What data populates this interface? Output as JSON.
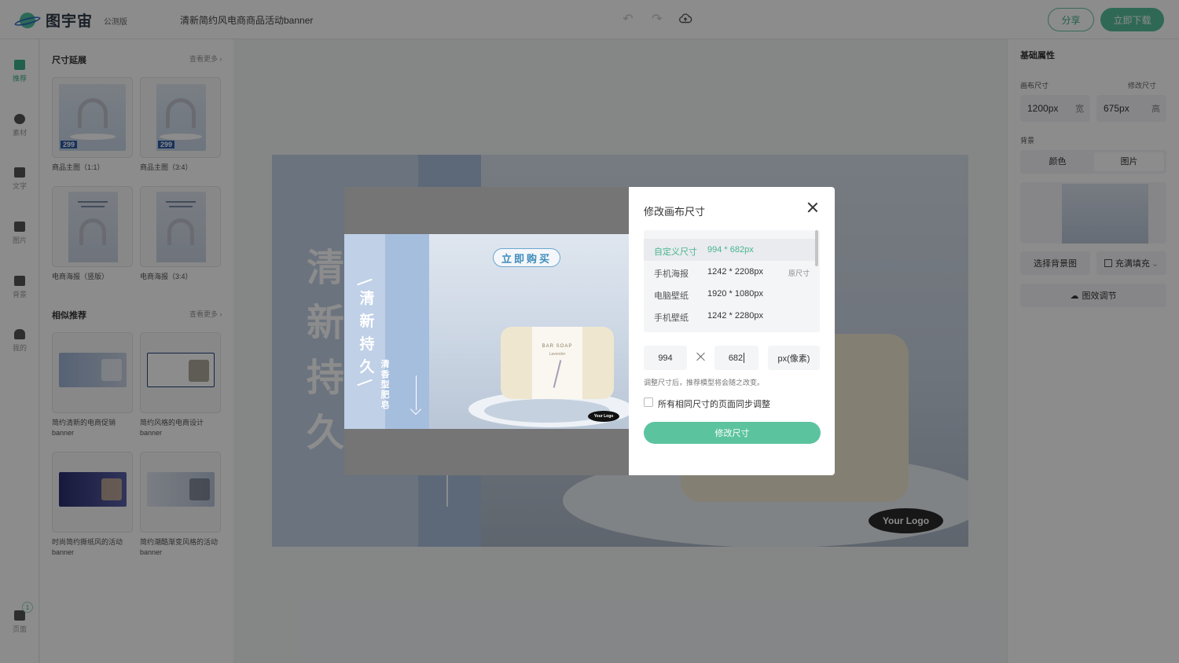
{
  "header": {
    "logo_text": "图宇宙",
    "beta_label": "公测版",
    "doc_title": "清新简约风电商商品活动banner",
    "share_label": "分享",
    "download_label": "立即下载",
    "undo_icon": "undo-icon",
    "redo_icon": "redo-icon",
    "cloud_icon": "cloud-upload-icon"
  },
  "rail": {
    "items": [
      {
        "label": "推荐",
        "icon": "recommend-icon"
      },
      {
        "label": "素材",
        "icon": "shapes-icon"
      },
      {
        "label": "文字",
        "icon": "text-icon"
      },
      {
        "label": "图片",
        "icon": "image-icon"
      },
      {
        "label": "背景",
        "icon": "background-icon"
      },
      {
        "label": "我的",
        "icon": "user-icon"
      },
      {
        "label": "页面",
        "icon": "pages-icon"
      }
    ],
    "page_count": "1"
  },
  "panel": {
    "section1_title": "尺寸延展",
    "section1_more": "查看更多",
    "section1_cards": [
      {
        "caption": "商品主图（1:1）",
        "price": "299"
      },
      {
        "caption": "商品主图（3:4）",
        "price": "299"
      },
      {
        "caption": "电商海报（竖版）"
      },
      {
        "caption": "电商海报（3:4）"
      }
    ],
    "section2_title": "相似推荐",
    "section2_more": "查看更多",
    "section2_cards": [
      {
        "caption": "简约清新的电商促销banner"
      },
      {
        "caption": "简约风格的电商设计banner"
      },
      {
        "caption": "时尚简约撕纸风的活动banner"
      },
      {
        "caption": "简约潮酷渐变风格的活动banner"
      }
    ]
  },
  "canvas": {
    "headline_chars": "清新持久",
    "logo_text": "Your Logo"
  },
  "rpanel": {
    "title": "基础属性",
    "canvas_size_label": "画布尺寸",
    "modify_link": "修改尺寸",
    "width_value": "1200px",
    "width_unit": "宽",
    "height_value": "675px",
    "height_unit": "高",
    "background_label": "背景",
    "tab_color": "颜色",
    "tab_image": "图片",
    "choose_bg": "选择背景图",
    "fill_mode": "充满填充",
    "effects": "图效调节"
  },
  "preview": {
    "buy_label": "立即购买",
    "headline": "清新持久",
    "sub": "清香型肥皂",
    "soap_brand": "BAR SOAP",
    "soap_sub": "Lavender",
    "logo": "Your Logo"
  },
  "modal": {
    "title": "修改画布尺寸",
    "sizes": [
      {
        "name": "自定义尺寸",
        "dim": "994 * 682px",
        "note": ""
      },
      {
        "name": "手机海报",
        "dim": "1242 * 2208px",
        "note": "原尺寸"
      },
      {
        "name": "电脑壁纸",
        "dim": "1920 * 1080px",
        "note": ""
      },
      {
        "name": "手机壁纸",
        "dim": "1242 * 2280px",
        "note": ""
      }
    ],
    "width_input": "994",
    "height_input": "682",
    "unit_select": "px(像素)",
    "hint": "调整尺寸后，推荐模型将会随之改变。",
    "sync_label": "所有相同尺寸的页面同步调整",
    "submit_label": "修改尺寸"
  }
}
